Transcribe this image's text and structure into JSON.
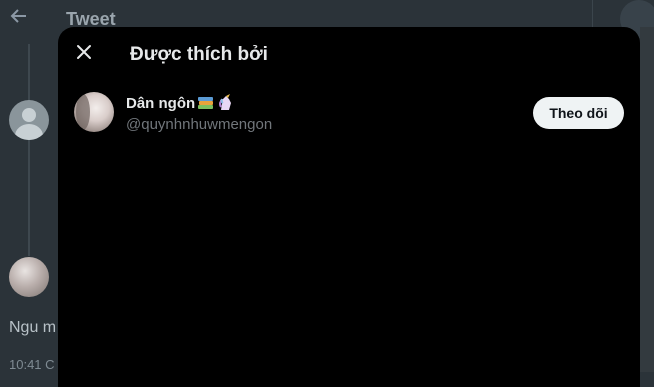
{
  "background": {
    "title": "Tweet",
    "tweet_text": "Ngu m",
    "tweet_time": "10:41 C",
    "icons": [
      "back-arrow-icon",
      "search-icon",
      "default-avatar-icon"
    ]
  },
  "modal": {
    "title": "Được thích bởi",
    "close_icon": "close-icon",
    "users": [
      {
        "name": "Dân ngôn",
        "name_emoji": [
          "books-emoji",
          "unicorn-emoji"
        ],
        "handle": "@quynhnhuwmengon",
        "follow_label": "Theo dõi"
      }
    ]
  },
  "colors": {
    "modal_bg": "#000000",
    "follow_button_bg": "#eff3f4",
    "handle_text": "#71767b",
    "page_bg": "#2b3339"
  }
}
